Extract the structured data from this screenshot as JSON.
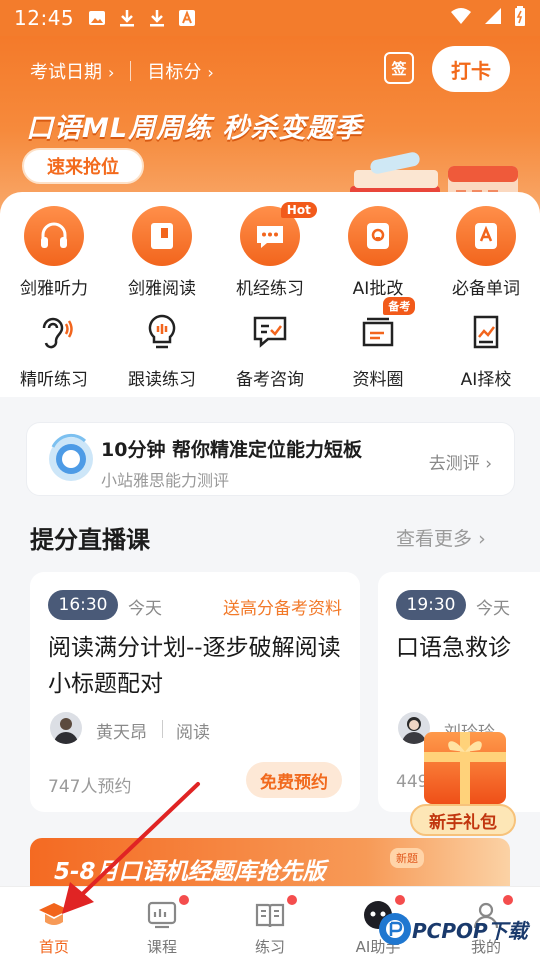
{
  "status_bar": {
    "time": "12:45"
  },
  "header": {
    "exam_date": "考试日期",
    "target_score": "目标分",
    "sign_label": "签",
    "checkin_label": "打卡",
    "banner_title": "口语ML周周练 秒杀变题季",
    "banner_button": "速来抢位"
  },
  "grid": [
    {
      "label": "剑雅听力",
      "icon": "headphones-icon"
    },
    {
      "label": "剑雅阅读",
      "icon": "book-icon"
    },
    {
      "label": "机经练习",
      "icon": "chat-icon",
      "badge": "Hot"
    },
    {
      "label": "AI批改",
      "icon": "ai-correct-icon"
    },
    {
      "label": "必备单词",
      "icon": "word-icon"
    },
    {
      "label": "精听练习",
      "icon": "ear-icon"
    },
    {
      "label": "跟读练习",
      "icon": "lightbulb-icon"
    },
    {
      "label": "备考咨询",
      "icon": "message-check-icon"
    },
    {
      "label": "资料圈",
      "icon": "folder-icon",
      "badge": "备考"
    },
    {
      "label": "AI择校",
      "icon": "school-chart-icon"
    }
  ],
  "test_card": {
    "title": "10分钟 帮你精准定位能力短板",
    "subtitle": "小站雅思能力测评",
    "action": "去测评"
  },
  "live_section": {
    "title": "提分直播课",
    "more": "查看更多",
    "courses": [
      {
        "time": "16:30",
        "day": "今天",
        "gift": "送高分备考资料",
        "title": "阅读满分计划--逐步破解阅读小标题配对",
        "teacher": "黄天昂",
        "subject": "阅读",
        "count": "747人预约",
        "button": "免费预约"
      },
      {
        "time": "19:30",
        "day": "今天",
        "title": "口语急救诊",
        "teacher": "刘玲玲",
        "count": "449"
      }
    ]
  },
  "new_user_gift": "新手礼包",
  "bottom_banner": {
    "text": "5-8月口语机经题库抢先版",
    "tag": "新题"
  },
  "tabs": [
    {
      "label": "首页",
      "icon": "graduation-cap-icon",
      "active": true,
      "dot": false
    },
    {
      "label": "课程",
      "icon": "course-icon",
      "active": false,
      "dot": true
    },
    {
      "label": "练习",
      "icon": "practice-book-icon",
      "active": false,
      "dot": true
    },
    {
      "label": "AI助手",
      "icon": "ai-assistant-icon",
      "active": false,
      "dot": true
    },
    {
      "label": "我的",
      "icon": "profile-icon",
      "active": false,
      "dot": true
    }
  ],
  "watermark": "PCPOP下载",
  "colors": {
    "brand": "#f37c2c",
    "accent": "#f2641b",
    "navy": "#4a5a78"
  }
}
